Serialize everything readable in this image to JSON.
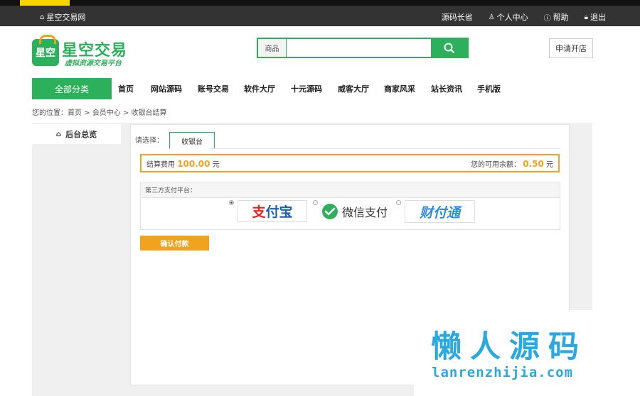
{
  "topbar": {
    "site_home": "星空交易网",
    "links": [
      "源码长省",
      "个人中心",
      "帮助",
      "退出"
    ]
  },
  "header": {
    "logo_name": "星空交易",
    "logo_bag": "星空",
    "logo_slogan": "虚拟资源交易平台",
    "search": {
      "category": "商品",
      "placeholder": ""
    },
    "open_store": "申请开店"
  },
  "nav": {
    "all_categories": "全部分类",
    "items": [
      "首页",
      "网站源码",
      "账号交易",
      "软件大厅",
      "十元源码",
      "威客大厅",
      "商家风采",
      "站长资讯",
      "手机版"
    ]
  },
  "breadcrumb": "您的位置：首页 > 会员中心 > 收银台结算",
  "sidebar": {
    "item": "后台总览"
  },
  "checkout": {
    "select_label": "请选择：",
    "tab": "收银台",
    "fee_label": "结算费用",
    "fee_amount": "100.00",
    "fee_unit": "元",
    "balance_label": "您的可用余额：",
    "balance_amount": "0.50",
    "balance_unit": "元",
    "platform_title": "第三方支付平台：",
    "methods": [
      {
        "name": "alipay",
        "selected": true
      },
      {
        "name": "wechat",
        "label": "微信支付",
        "selected": false
      },
      {
        "name": "tenpay",
        "selected": false
      }
    ],
    "alipay_logo_a": "支",
    "alipay_logo_b": "付宝",
    "tenpay_logo": "财付通",
    "confirm_label": "确认付款"
  },
  "watermark": {
    "title": "懒人源码",
    "url": "lanrenzhijia.com"
  },
  "colors": {
    "brand_green": "#2db05b",
    "accent_orange": "#f0a31f",
    "topbar": "#333333",
    "watermark_blue": "#29a9e0"
  }
}
